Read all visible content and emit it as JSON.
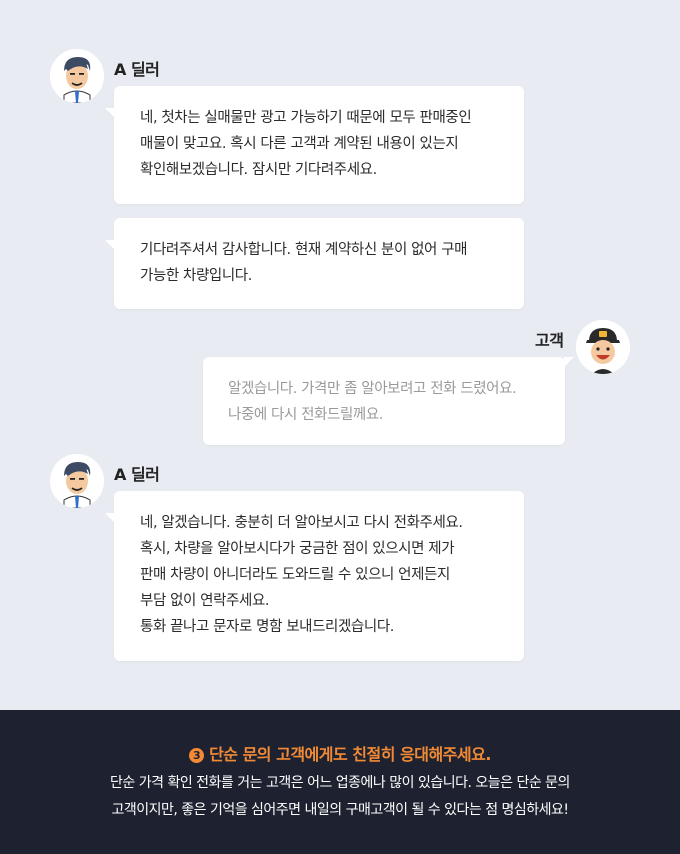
{
  "messages": [
    {
      "speaker": "A 딜러",
      "lines": [
        "네, 첫차는 실매물만 광고 가능하기 때문에 모두 판매중인",
        "매물이 맞고요. 혹시 다른 고객과 계약된 내용이 있는지",
        "확인해보겠습니다. 잠시만 기다려주세요."
      ]
    },
    {
      "speaker": "",
      "lines": [
        "기다려주셔서 감사합니다. 현재 계약하신 분이 없어 구매",
        "가능한 차량입니다."
      ]
    },
    {
      "speaker": "고객",
      "lines": [
        "알겠습니다. 가격만 좀 알아보려고 전화 드렸어요.",
        "나중에 다시 전화드릴께요."
      ]
    },
    {
      "speaker": "A 딜러",
      "lines": [
        "네, 알겠습니다. 충분히 더 알아보시고 다시 전화주세요.",
        "혹시, 차량을 알아보시다가 궁금한 점이 있으시면 제가",
        "판매 차량이 아니더라도 도와드릴 수 있으니 언제든지",
        "부담 없이 연락주세요.",
        "통화 끝나고 문자로 명함 보내드리겠습니다."
      ]
    }
  ],
  "avatars": {
    "dealer": "dealer-avatar-icon",
    "customer": "customer-avatar-icon"
  },
  "tip": {
    "number": "3",
    "title": "단순 문의 고객에게도 친절히 응대해주세요.",
    "lines": [
      "단순 가격 확인 전화를 거는 고객은 어느 업종에나 많이 있습니다. 오늘은 단순 문의",
      "고객이지만, 좋은 기억을 심어주면 내일의 구매고객이 될 수 있다는 점 명심하세요!"
    ]
  },
  "colors": {
    "background": "#e8ebf1",
    "bubble": "#ffffff",
    "footer": "#1e2230",
    "accent": "#f28a35",
    "muted_text": "#9a9a9a"
  }
}
